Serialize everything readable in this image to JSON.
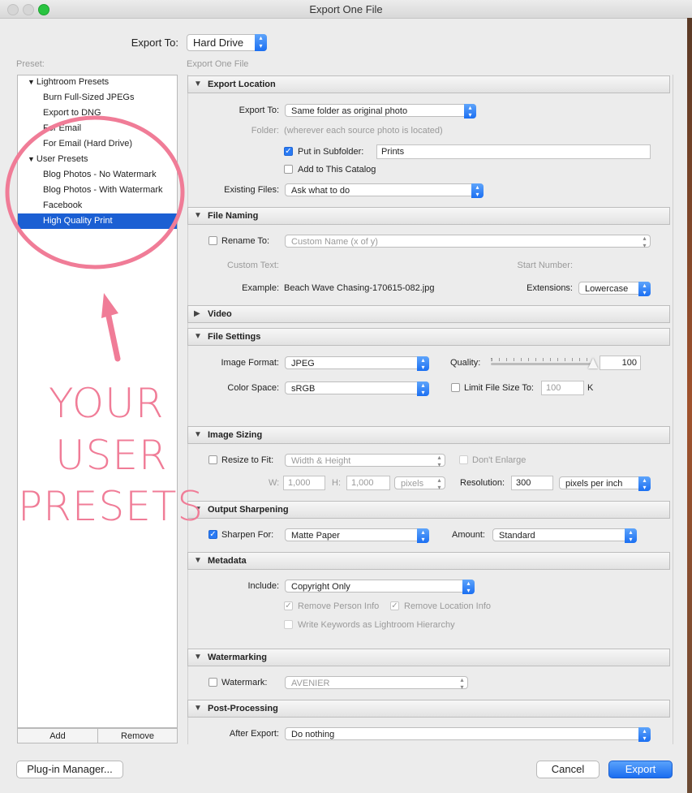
{
  "window": {
    "title": "Export One File"
  },
  "top": {
    "export_to_label": "Export To:",
    "export_to_value": "Hard Drive"
  },
  "presets": {
    "header": "Preset:",
    "groups": [
      {
        "label": "Lightroom Presets",
        "items": [
          "Burn Full-Sized JPEGs",
          "Export to DNG",
          "For Email",
          "For Email (Hard Drive)"
        ]
      },
      {
        "label": "User Presets",
        "items": [
          "Blog Photos - No Watermark",
          "Blog Photos - With Watermark",
          "Facebook",
          "High Quality Print"
        ]
      }
    ],
    "selected": "High Quality Print",
    "add_label": "Add",
    "remove_label": "Remove"
  },
  "panel_header": "Export One File",
  "export_location": {
    "title": "Export Location",
    "export_to_label": "Export To:",
    "export_to_value": "Same folder as original photo",
    "folder_label": "Folder:",
    "folder_value": "(wherever each source photo is located)",
    "subfolder_label": "Put in Subfolder:",
    "subfolder_checked": true,
    "subfolder_value": "Prints",
    "catalog_label": "Add to This Catalog",
    "catalog_checked": false,
    "existing_label": "Existing Files:",
    "existing_value": "Ask what to do"
  },
  "file_naming": {
    "title": "File Naming",
    "rename_label": "Rename To:",
    "rename_checked": false,
    "rename_value": "Custom Name (x of y)",
    "custom_text_label": "Custom Text:",
    "start_number_label": "Start Number:",
    "example_label": "Example:",
    "example_value": "Beach Wave Chasing-170615-082.jpg",
    "extensions_label": "Extensions:",
    "extensions_value": "Lowercase"
  },
  "video": {
    "title": "Video"
  },
  "file_settings": {
    "title": "File Settings",
    "format_label": "Image Format:",
    "format_value": "JPEG",
    "quality_label": "Quality:",
    "quality_value": "100",
    "quality_fraction": 1.0,
    "color_label": "Color Space:",
    "color_value": "sRGB",
    "limit_label": "Limit File Size To:",
    "limit_checked": false,
    "limit_value": "100",
    "limit_unit": "K"
  },
  "image_sizing": {
    "title": "Image Sizing",
    "resize_label": "Resize to Fit:",
    "resize_checked": false,
    "resize_value": "Width & Height",
    "enlarge_label": "Don't Enlarge",
    "w_label": "W:",
    "w_value": "1,000",
    "h_label": "H:",
    "h_value": "1,000",
    "unit_value": "pixels",
    "resolution_label": "Resolution:",
    "resolution_value": "300",
    "resolution_unit": "pixels per inch"
  },
  "output_sharpening": {
    "title": "Output Sharpening",
    "sharpen_label": "Sharpen For:",
    "sharpen_checked": true,
    "sharpen_value": "Matte Paper",
    "amount_label": "Amount:",
    "amount_value": "Standard"
  },
  "metadata": {
    "title": "Metadata",
    "include_label": "Include:",
    "include_value": "Copyright Only",
    "person_label": "Remove Person Info",
    "location_label": "Remove Location Info",
    "keywords_label": "Write Keywords as Lightroom Hierarchy"
  },
  "watermarking": {
    "title": "Watermarking",
    "watermark_label": "Watermark:",
    "watermark_checked": false,
    "watermark_value": "AVENIER"
  },
  "post_processing": {
    "title": "Post-Processing",
    "after_label": "After Export:",
    "after_value": "Do nothing"
  },
  "footer": {
    "plugin_label": "Plug-in Manager...",
    "cancel_label": "Cancel",
    "export_label": "Export"
  },
  "annotation": {
    "lines": [
      "YOUR",
      "USER",
      "PRESETS"
    ],
    "color": "#f07c97"
  },
  "colors": {
    "accent": "#1b6ff2",
    "selection": "#1b5fd3"
  }
}
